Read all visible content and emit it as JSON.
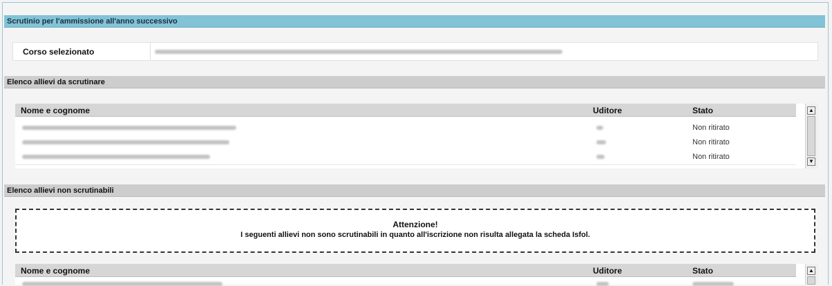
{
  "title": "Scrutinio per l'ammissione all'anno successivo",
  "corso": {
    "label": "Corso selezionato"
  },
  "section_da_scrutinare": {
    "title": "Elenco allievi da scrutinare",
    "columns": [
      "Nome e cognome",
      "Uditore",
      "Stato"
    ],
    "rows": [
      {
        "stato": "Non ritirato"
      },
      {
        "stato": "Non ritirato"
      },
      {
        "stato": "Non ritirato"
      }
    ]
  },
  "section_non_scrutinabili": {
    "title": "Elenco allievi non scrutinabili",
    "warning_title": "Attenzione!",
    "warning_text": "I seguenti allievi non sono scrutinabili in quanto all'iscrizione non risulta allegata la scheda Isfol.",
    "columns": [
      "Nome e cognome",
      "Uditore",
      "Stato"
    ]
  },
  "colors": {
    "title_bar": "#82c3d8",
    "section_bar": "#cdcdcd"
  }
}
